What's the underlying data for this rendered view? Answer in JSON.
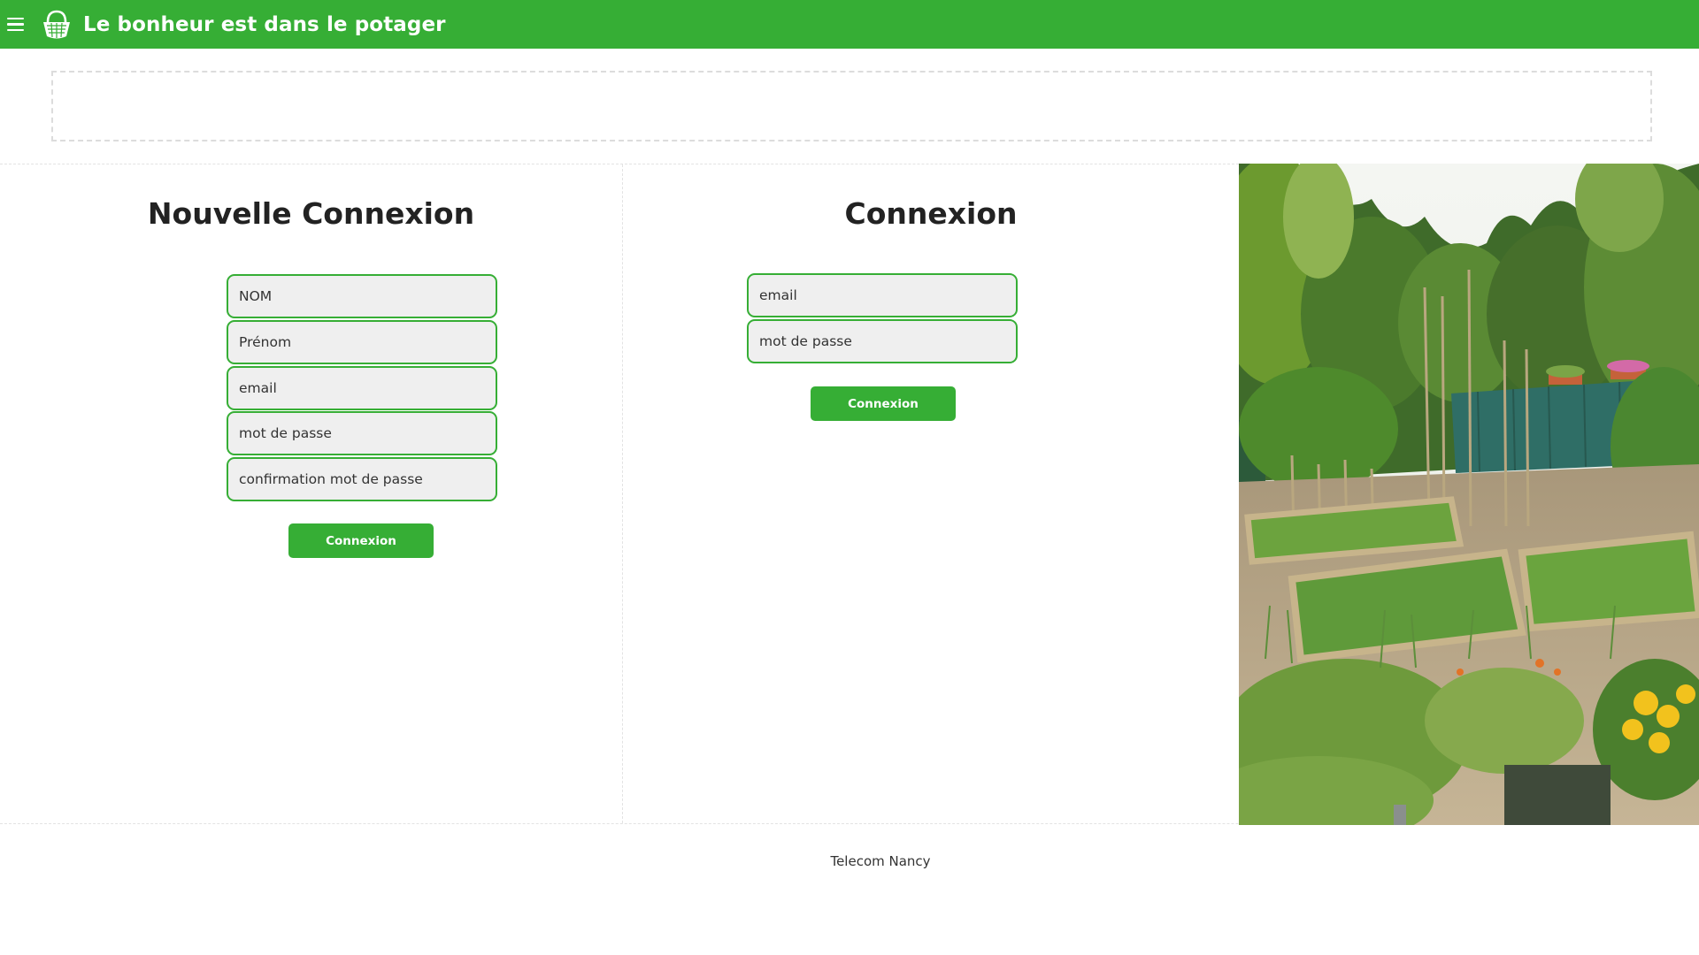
{
  "header": {
    "title": "Le bonheur est dans le potager",
    "menu_icon": "hamburger-menu-icon",
    "logo_icon": "basket-logo-icon",
    "accent_color": "#36ae35"
  },
  "register": {
    "heading": "Nouvelle Connexion",
    "fields": {
      "nom": "NOM",
      "prenom": "Prénom",
      "email": "email",
      "password": "mot de passe",
      "password_confirm": "confirmation mot de passe"
    },
    "submit_label": "Connexion"
  },
  "login": {
    "heading": "Connexion",
    "fields": {
      "email": "email",
      "password": "mot de passe"
    },
    "submit_label": "Connexion"
  },
  "footer": {
    "text": "Telecom Nancy"
  }
}
